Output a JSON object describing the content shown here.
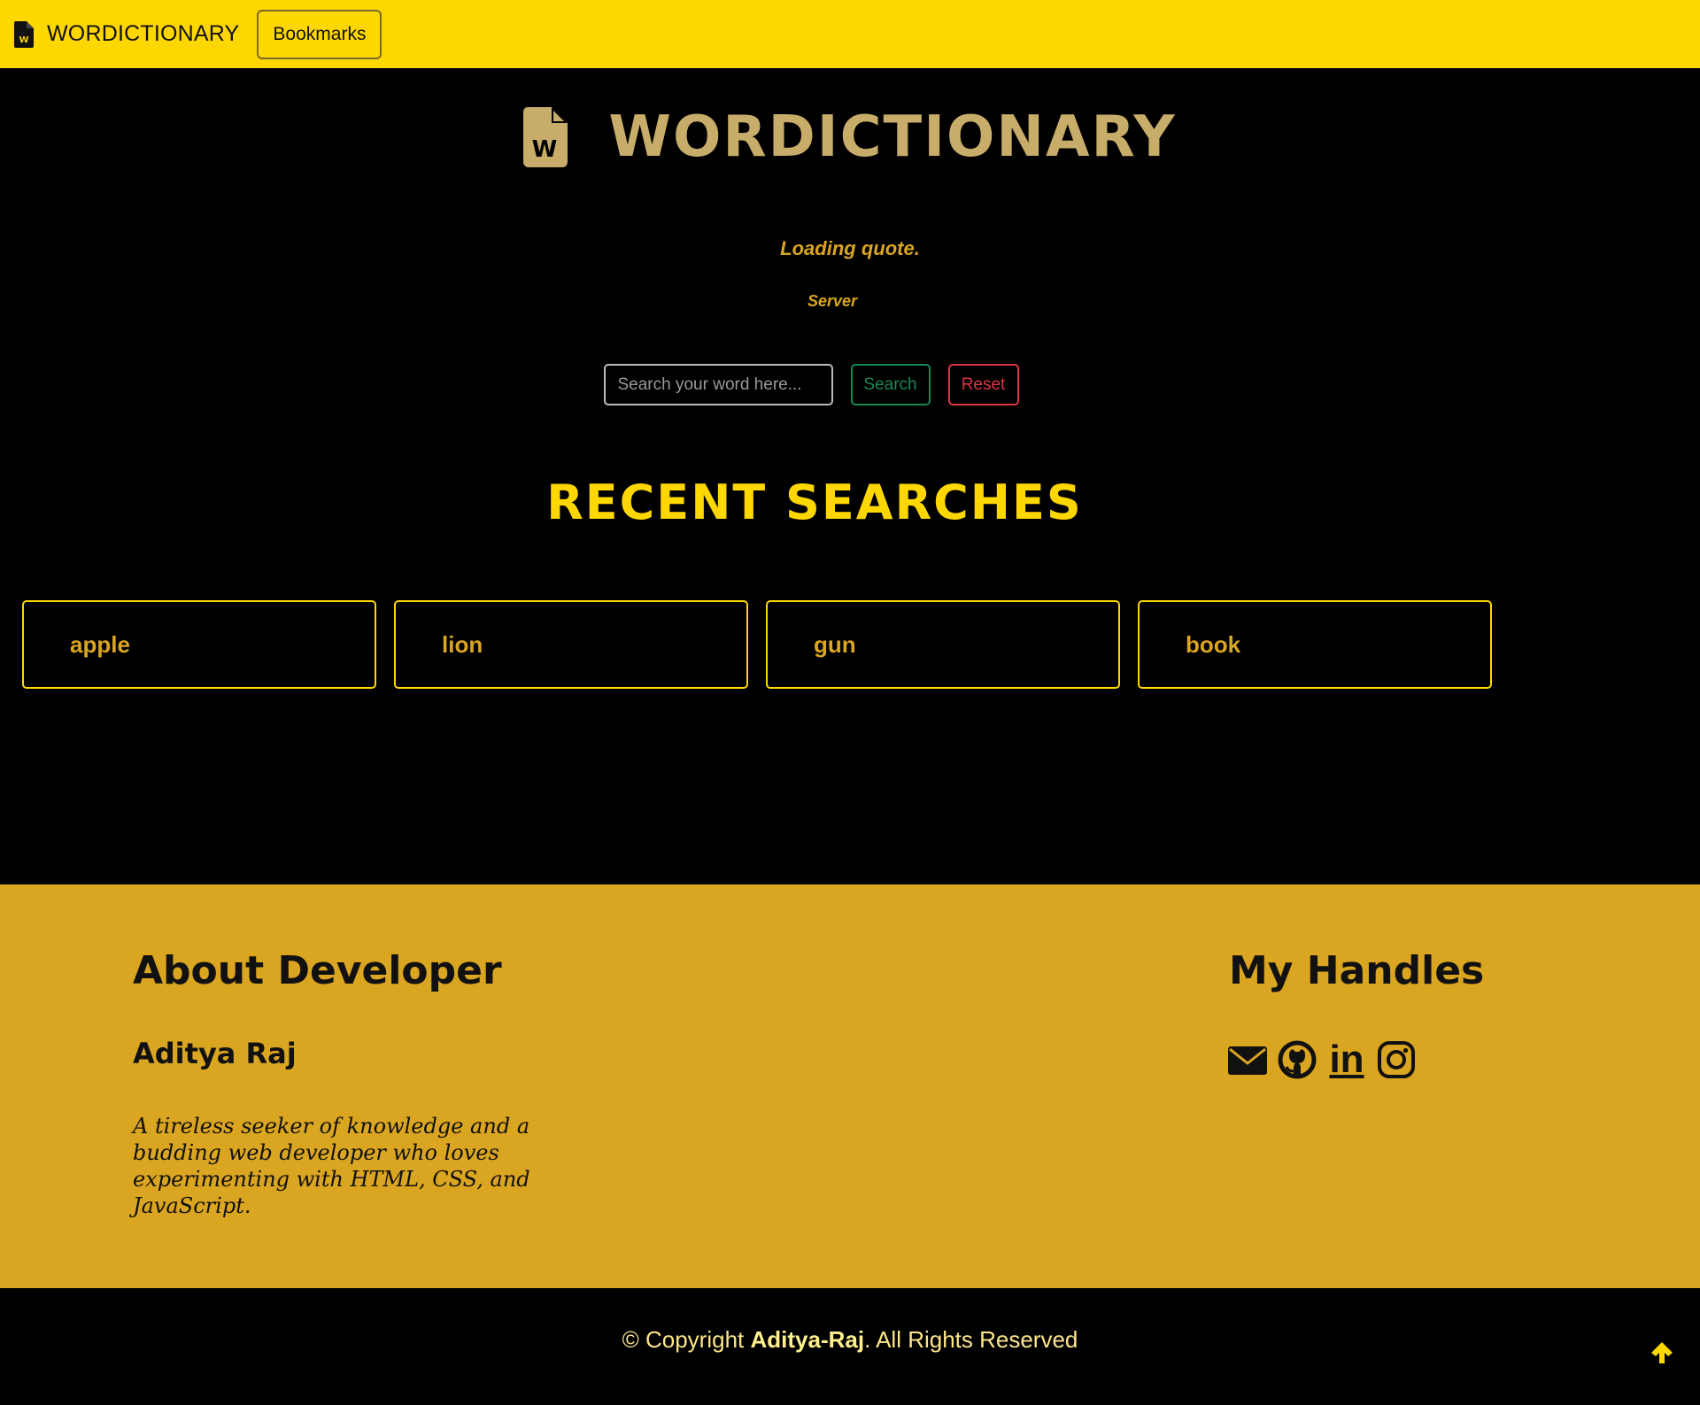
{
  "navbar": {
    "brand": "WORDICTIONARY",
    "bookmarks_label": "Bookmarks"
  },
  "hero": {
    "title": "WORDICTIONARY",
    "quote": "Loading quote.",
    "quote_author": "Server"
  },
  "search": {
    "placeholder": "Search your word here...",
    "search_label": "Search",
    "reset_label": "Reset"
  },
  "recent": {
    "title": "RECENT SEARCHES",
    "items": [
      "apple",
      "lion",
      "gun",
      "book"
    ]
  },
  "footer": {
    "about_title": "About Developer",
    "developer_name": "Aditya Raj",
    "bio": "A tireless seeker of knowledge and a budding web developer who loves experimenting with HTML, CSS, and JavaScript.",
    "handles_title": "My Handles",
    "handles": [
      "email-icon",
      "github-icon",
      "linkedin-icon",
      "instagram-icon"
    ],
    "linkedin_text": "in"
  },
  "bottom": {
    "copyright_prefix": "© Copyright ",
    "copyright_name": "Aditya-Raj",
    "copyright_suffix": ". All Rights Reserved"
  },
  "colors": {
    "accent": "#ffd700",
    "footer": "#daa520",
    "hero_title": "#c8ad6a",
    "search": "#198754",
    "reset": "#dc3545"
  }
}
